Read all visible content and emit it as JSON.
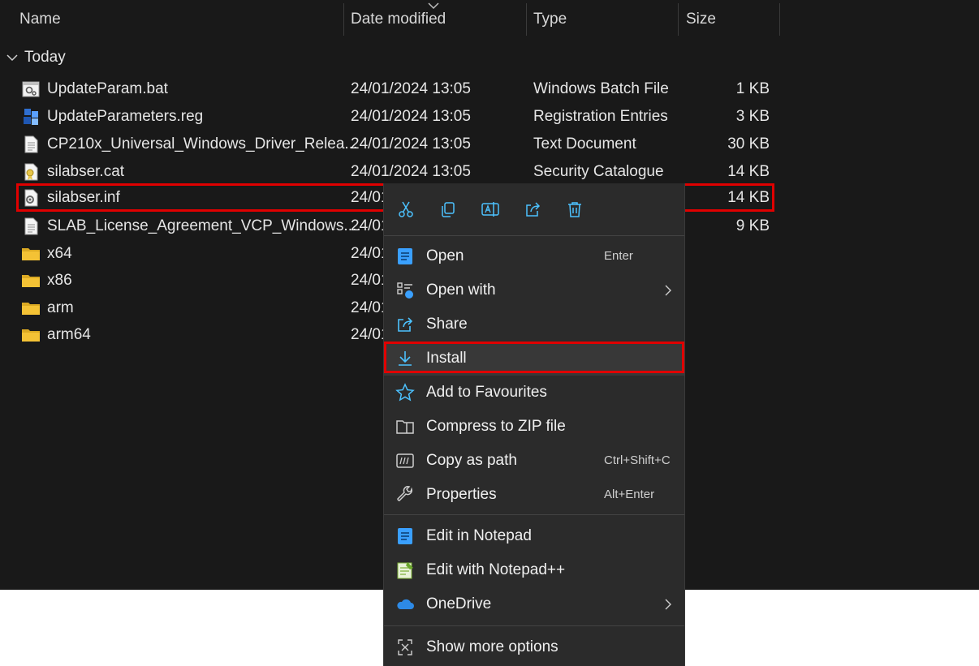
{
  "columns": {
    "name": "Name",
    "date_modified": "Date modified",
    "type": "Type",
    "size": "Size"
  },
  "group": {
    "label": "Today"
  },
  "files": [
    {
      "name": "UpdateParam.bat",
      "date": "24/01/2024 13:05",
      "type": "Windows Batch File",
      "size": "1 KB",
      "icon": "batch-file-icon"
    },
    {
      "name": "UpdateParameters.reg",
      "date": "24/01/2024 13:05",
      "type": "Registration Entries",
      "size": "3 KB",
      "icon": "registry-file-icon"
    },
    {
      "name": "CP210x_Universal_Windows_Driver_Relea...",
      "date": "24/01/2024 13:05",
      "type": "Text Document",
      "size": "30 KB",
      "icon": "text-file-icon"
    },
    {
      "name": "silabser.cat",
      "date": "24/01/2024 13:05",
      "type": "Security Catalogue",
      "size": "14 KB",
      "icon": "catalog-file-icon"
    },
    {
      "name": "silabser.inf",
      "date": "24/01",
      "type": "",
      "size": "14 KB",
      "icon": "inf-file-icon"
    },
    {
      "name": "SLAB_License_Agreement_VCP_Windows....",
      "date": "24/01",
      "type": "",
      "size": "9 KB",
      "icon": "text-file-icon"
    },
    {
      "name": "x64",
      "date": "24/01",
      "type": "",
      "size": "",
      "icon": "folder-icon"
    },
    {
      "name": "x86",
      "date": "24/01",
      "type": "",
      "size": "",
      "icon": "folder-icon"
    },
    {
      "name": "arm",
      "date": "24/01",
      "type": "",
      "size": "",
      "icon": "folder-icon"
    },
    {
      "name": "arm64",
      "date": "24/01",
      "type": "",
      "size": "",
      "icon": "folder-icon"
    }
  ],
  "context_menu": {
    "quick_actions": [
      "cut-icon",
      "copy-icon",
      "rename-icon",
      "share-icon",
      "delete-icon"
    ],
    "items": [
      {
        "label": "Open",
        "shortcut": "Enter",
        "icon": "notepad-icon"
      },
      {
        "label": "Open with",
        "shortcut": "",
        "icon": "open-with-icon",
        "submenu": true
      },
      {
        "label": "Share",
        "shortcut": "",
        "icon": "share-icon"
      },
      {
        "label": "Install",
        "shortcut": "",
        "icon": "install-icon"
      },
      {
        "label": "Add to Favourites",
        "shortcut": "",
        "icon": "star-icon"
      },
      {
        "label": "Compress to ZIP file",
        "shortcut": "",
        "icon": "zip-folder-icon"
      },
      {
        "label": "Copy as path",
        "shortcut": "Ctrl+Shift+C",
        "icon": "copy-path-icon"
      },
      {
        "label": "Properties",
        "shortcut": "Alt+Enter",
        "icon": "wrench-icon"
      },
      {
        "label": "Edit in Notepad",
        "shortcut": "",
        "icon": "notepad-icon"
      },
      {
        "label": "Edit with Notepad++",
        "shortcut": "",
        "icon": "notepad-plus-plus-icon"
      },
      {
        "label": "OneDrive",
        "shortcut": "",
        "icon": "onedrive-cloud-icon",
        "submenu": true
      },
      {
        "label": "Show more options",
        "shortcut": "",
        "icon": "show-more-options-icon"
      }
    ]
  },
  "colors": {
    "background": "#191919",
    "menu_background": "#2b2b2b",
    "highlight_border": "#e00000",
    "accent_blue": "#4cc2ff",
    "folder_yellow": "#f4c235"
  }
}
